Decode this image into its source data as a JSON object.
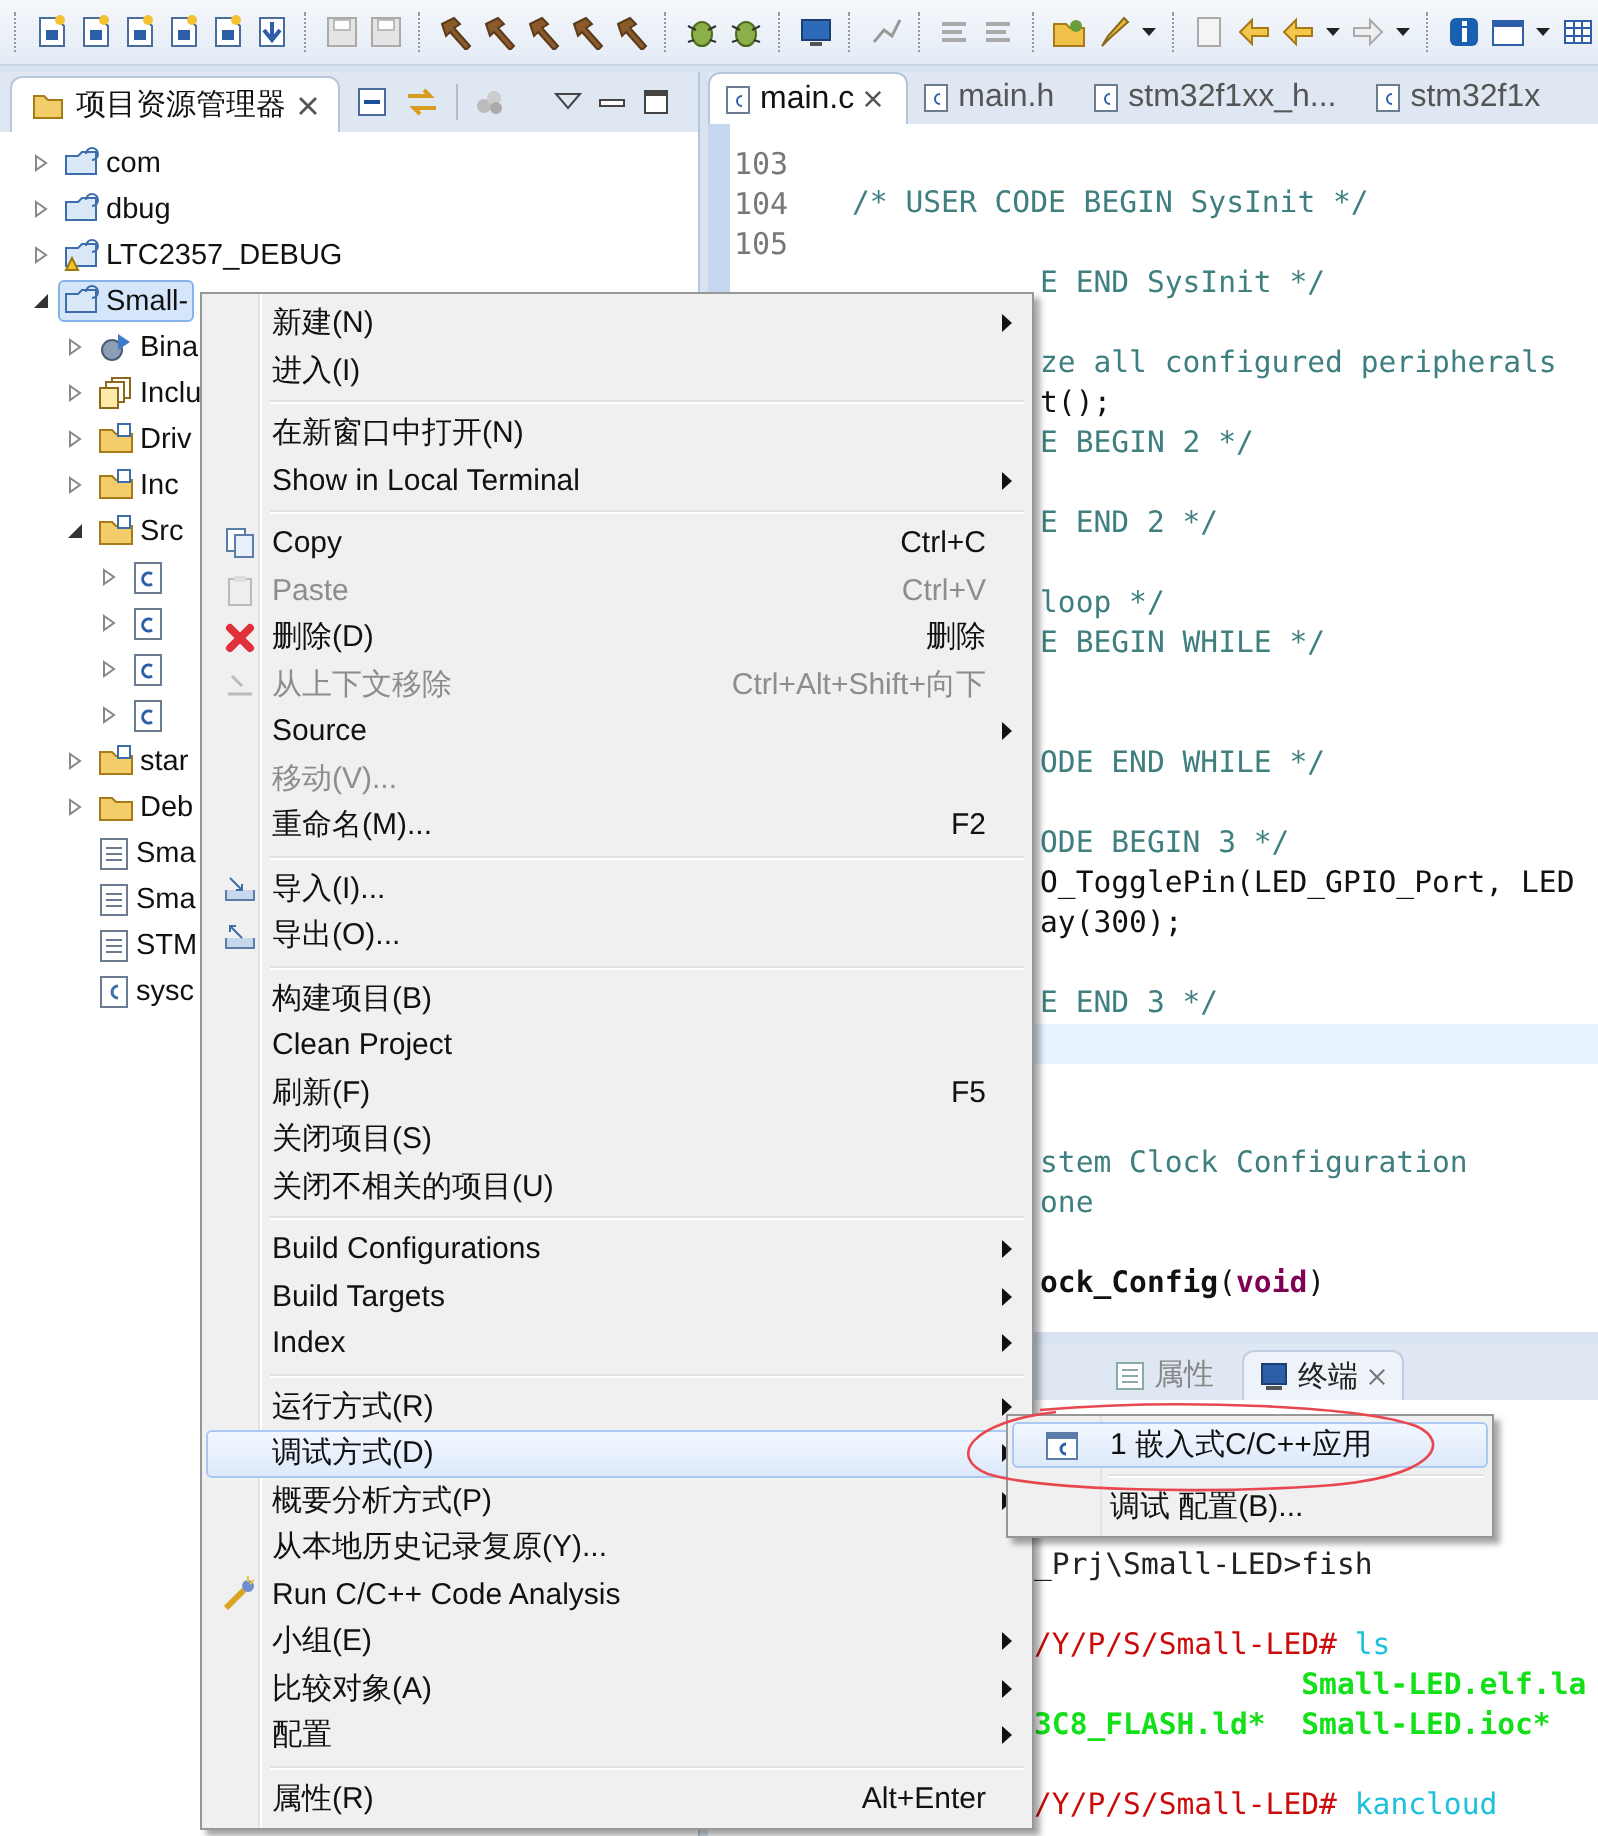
{
  "explorer": {
    "title": "项目资源管理器",
    "tree": [
      {
        "label": "com",
        "kind": "project",
        "expanded": false,
        "selected": false
      },
      {
        "label": "dbug",
        "kind": "project",
        "expanded": false,
        "selected": false
      },
      {
        "label": "LTC2357_DEBUG",
        "kind": "warning-project",
        "expanded": false,
        "selected": false
      },
      {
        "label": "Small-",
        "kind": "project",
        "expanded": true,
        "selected": true,
        "children": [
          {
            "label": "Bina",
            "kind": "binaries",
            "expanded": false,
            "selected": false
          },
          {
            "label": "Inclu",
            "kind": "includes",
            "expanded": false,
            "selected": false
          },
          {
            "label": "Driv",
            "kind": "source-folder",
            "expanded": false,
            "selected": false
          },
          {
            "label": "Inc",
            "kind": "source-folder",
            "expanded": false,
            "selected": false
          },
          {
            "label": "Src",
            "kind": "source-folder",
            "expanded": true,
            "selected": false,
            "children": [
              {
                "kind": "c-file",
                "expanded": false,
                "selected": false
              },
              {
                "kind": "c-file",
                "expanded": false,
                "selected": false
              },
              {
                "kind": "c-file",
                "expanded": false,
                "selected": false
              },
              {
                "kind": "c-file",
                "expanded": false,
                "selected": false
              }
            ]
          },
          {
            "label": "star",
            "kind": "source-folder",
            "expanded": false,
            "selected": false
          },
          {
            "label": "Deb",
            "kind": "folder",
            "expanded": false,
            "selected": false
          },
          {
            "label": "Sma",
            "kind": "text-file",
            "selected": false
          },
          {
            "label": "Sma",
            "kind": "text-file",
            "selected": false
          },
          {
            "label": "STM",
            "kind": "text-file",
            "selected": false
          },
          {
            "label": "sysc",
            "kind": "script-file",
            "selected": false
          }
        ]
      }
    ]
  },
  "editor": {
    "tabs": [
      {
        "label": "main.c",
        "selected": true
      },
      {
        "label": "main.h",
        "selected": false
      },
      {
        "label": "stm32f1xx_h...",
        "selected": false
      },
      {
        "label": "stm32f1x",
        "selected": false
      }
    ],
    "lines": [
      {
        "number": "103",
        "kind": "blank"
      },
      {
        "number": "104",
        "kind": "full",
        "tokens": [
          {
            "text": "/* USER CODE BEGIN SysInit */",
            "kind": "comment"
          }
        ]
      },
      {
        "number": "105",
        "kind": "blank"
      },
      {
        "kind": "after-menu",
        "tokens": [
          {
            "text": "E END SysInit */",
            "kind": "comment"
          }
        ]
      },
      {
        "kind": "blank"
      },
      {
        "kind": "after-menu",
        "tokens": [
          {
            "text": "ze all configured peripherals",
            "kind": "comment"
          }
        ]
      },
      {
        "kind": "after-menu",
        "tokens": [
          {
            "text": "t();",
            "kind": "code"
          }
        ]
      },
      {
        "kind": "after-menu",
        "tokens": [
          {
            "text": "E BEGIN 2 */",
            "kind": "comment"
          }
        ]
      },
      {
        "kind": "blank"
      },
      {
        "kind": "after-menu",
        "tokens": [
          {
            "text": "E END 2 */",
            "kind": "comment"
          }
        ]
      },
      {
        "kind": "blank"
      },
      {
        "kind": "after-menu",
        "tokens": [
          {
            "text": "loop */",
            "kind": "comment"
          }
        ]
      },
      {
        "kind": "after-menu",
        "tokens": [
          {
            "text": "E BEGIN WHILE */",
            "kind": "comment"
          }
        ]
      },
      {
        "kind": "blank"
      },
      {
        "kind": "blank"
      },
      {
        "kind": "after-menu",
        "tokens": [
          {
            "text": "ODE END WHILE */",
            "kind": "comment"
          }
        ]
      },
      {
        "kind": "blank"
      },
      {
        "kind": "after-menu",
        "tokens": [
          {
            "text": "ODE BEGIN 3 */",
            "kind": "comment"
          }
        ]
      },
      {
        "kind": "after-menu",
        "tokens": [
          {
            "text": "O_TogglePin(LED_GPIO_Port, LED",
            "kind": "code"
          }
        ]
      },
      {
        "kind": "after-menu",
        "tokens": [
          {
            "text": "ay(300);",
            "kind": "code"
          }
        ]
      },
      {
        "kind": "blank"
      },
      {
        "kind": "after-menu",
        "tokens": [
          {
            "text": "E END 3 */",
            "kind": "comment"
          }
        ]
      },
      {
        "kind": "current"
      },
      {
        "kind": "blank"
      },
      {
        "kind": "blank"
      },
      {
        "kind": "after-menu",
        "tokens": [
          {
            "text": "stem Clock Configuration",
            "kind": "comment"
          }
        ]
      },
      {
        "kind": "after-menu",
        "tokens": [
          {
            "text": "one",
            "kind": "comment"
          }
        ]
      },
      {
        "kind": "blank"
      },
      {
        "kind": "after-menu",
        "tokens": [
          {
            "text": "ock_Config",
            "kind": "function"
          },
          {
            "text": "(",
            "kind": "code"
          },
          {
            "text": "void",
            "kind": "keyword"
          },
          {
            "text": ")",
            "kind": "code"
          }
        ]
      }
    ]
  },
  "bottom_panel": {
    "tabs": [
      {
        "label": "属性",
        "selected": false
      },
      {
        "label": "终端",
        "selected": true
      }
    ],
    "terminal": [
      {
        "kind": "text",
        "tokens": [
          {
            "text": "_Prj\\Small-LED>fish",
            "kind": "plain"
          }
        ]
      },
      {
        "kind": "blank"
      },
      {
        "kind": "text",
        "tokens": [
          {
            "text": "/Y/P/S/Small-LED#",
            "kind": "prompt"
          },
          {
            "text": "ls",
            "kind": "command"
          }
        ]
      },
      {
        "kind": "listing",
        "column_2": "Small-LED.elf.la"
      },
      {
        "kind": "listing",
        "column_1": "3C8_FLASH.ld*",
        "column_2": "Small-LED.ioc*"
      },
      {
        "kind": "blank"
      },
      {
        "kind": "text",
        "tokens": [
          {
            "text": "/Y/P/S/Small-LED#",
            "kind": "prompt"
          },
          {
            "text": "kancloud",
            "kind": "command"
          }
        ]
      }
    ]
  },
  "context_menu": {
    "items": [
      {
        "kind": "plain",
        "label": "新建(N)",
        "submenu": true,
        "disabled": false,
        "selected": false
      },
      {
        "kind": "plain",
        "label": "进入(I)",
        "submenu": false,
        "disabled": false,
        "selected": false
      },
      {
        "kind": "separator"
      },
      {
        "kind": "plain",
        "label": "在新窗口中打开(N)",
        "submenu": false,
        "disabled": false,
        "selected": false
      },
      {
        "kind": "plain",
        "label": "Show in Local Terminal",
        "submenu": true,
        "disabled": false,
        "selected": false
      },
      {
        "kind": "separator"
      },
      {
        "kind": "copy",
        "label": "Copy",
        "shortcut": "Ctrl+C",
        "submenu": false,
        "disabled": false,
        "selected": false
      },
      {
        "kind": "paste",
        "label": "Paste",
        "shortcut": "Ctrl+V",
        "submenu": false,
        "disabled": true,
        "selected": false
      },
      {
        "kind": "delete",
        "label": "删除(D)",
        "shortcut": "删除",
        "submenu": false,
        "disabled": false,
        "selected": false
      },
      {
        "kind": "remove",
        "label": "从上下文移除",
        "shortcut": "Ctrl+Alt+Shift+向下",
        "submenu": false,
        "disabled": true,
        "selected": false
      },
      {
        "kind": "plain",
        "label": "Source",
        "submenu": true,
        "disabled": false,
        "selected": false
      },
      {
        "kind": "plain",
        "label": "移动(V)...",
        "submenu": false,
        "disabled": true,
        "selected": false
      },
      {
        "kind": "plain",
        "label": "重命名(M)...",
        "shortcut": "F2",
        "submenu": false,
        "disabled": false,
        "selected": false
      },
      {
        "kind": "separator"
      },
      {
        "kind": "import",
        "label": "导入(I)...",
        "submenu": false,
        "disabled": false,
        "selected": false
      },
      {
        "kind": "export",
        "label": "导出(O)...",
        "submenu": false,
        "disabled": false,
        "selected": false
      },
      {
        "kind": "separator"
      },
      {
        "kind": "plain",
        "label": "构建项目(B)",
        "submenu": false,
        "disabled": false,
        "selected": false
      },
      {
        "kind": "plain",
        "label": "Clean Project",
        "submenu": false,
        "disabled": false,
        "selected": false
      },
      {
        "kind": "plain",
        "label": "刷新(F)",
        "shortcut": "F5",
        "submenu": false,
        "disabled": false,
        "selected": false
      },
      {
        "kind": "plain",
        "label": "关闭项目(S)",
        "submenu": false,
        "disabled": false,
        "selected": false
      },
      {
        "kind": "plain",
        "label": "关闭不相关的项目(U)",
        "submenu": false,
        "disabled": false,
        "selected": false
      },
      {
        "kind": "separator"
      },
      {
        "kind": "plain",
        "label": "Build Configurations",
        "submenu": true,
        "disabled": false,
        "selected": false
      },
      {
        "kind": "plain",
        "label": "Build Targets",
        "submenu": true,
        "disabled": false,
        "selected": false
      },
      {
        "kind": "plain",
        "label": "Index",
        "submenu": true,
        "disabled": false,
        "selected": false
      },
      {
        "kind": "separator"
      },
      {
        "kind": "plain",
        "label": "运行方式(R)",
        "submenu": true,
        "disabled": false,
        "selected": false
      },
      {
        "kind": "plain",
        "label": "调试方式(D)",
        "submenu": true,
        "disabled": false,
        "selected": true
      },
      {
        "kind": "plain",
        "label": "概要分析方式(P)",
        "submenu": true,
        "disabled": false,
        "selected": false
      },
      {
        "kind": "plain",
        "label": "从本地历史记录复原(Y)...",
        "submenu": false,
        "disabled": false,
        "selected": false
      },
      {
        "kind": "analysis",
        "label": "Run C/C++ Code Analysis",
        "submenu": false,
        "disabled": false,
        "selected": false
      },
      {
        "kind": "plain",
        "label": "小组(E)",
        "submenu": true,
        "disabled": false,
        "selected": false
      },
      {
        "kind": "plain",
        "label": "比较对象(A)",
        "submenu": true,
        "disabled": false,
        "selected": false
      },
      {
        "kind": "plain",
        "label": "配置",
        "submenu": true,
        "disabled": false,
        "selected": false
      },
      {
        "kind": "separator"
      },
      {
        "kind": "plain",
        "label": "属性(R)",
        "shortcut": "Alt+Enter",
        "submenu": false,
        "disabled": false,
        "selected": false
      }
    ]
  },
  "submenu": {
    "items": [
      {
        "kind": "c-app",
        "label": "1 嵌入式C/C++应用",
        "selected": true,
        "annotated": true
      },
      {
        "kind": "separator"
      },
      {
        "kind": "plain",
        "label": "调试 配置(B)...",
        "selected": false,
        "annotated": false
      }
    ]
  }
}
